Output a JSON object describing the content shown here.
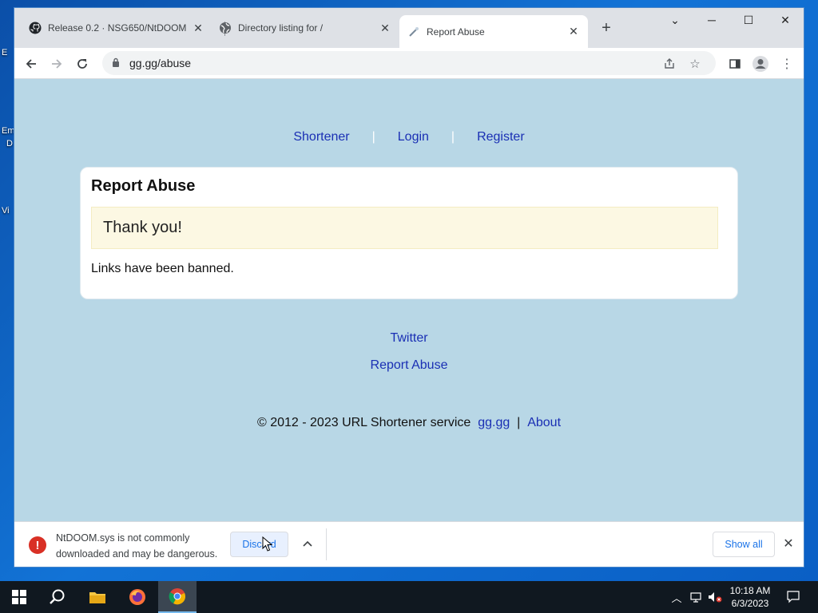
{
  "desktop": {
    "icons": [
      "E",
      "Em",
      "D",
      "Vi"
    ]
  },
  "browser": {
    "tabs": [
      {
        "title": "Release 0.2 · NSG650/NtDOOM",
        "icon": "github-icon"
      },
      {
        "title": "Directory listing for /",
        "icon": "globe-icon"
      },
      {
        "title": "Report Abuse",
        "icon": "link-icon",
        "active": true
      }
    ],
    "url": "gg.gg/abuse"
  },
  "page": {
    "nav": {
      "shortener": "Shortener",
      "sep1": "|",
      "login": "Login",
      "sep2": "|",
      "register": "Register"
    },
    "card": {
      "title": "Report Abuse",
      "alert": "Thank you!",
      "message": "Links have been banned."
    },
    "footer": {
      "twitter": "Twitter",
      "report": "Report Abuse",
      "copyright": "© 2012 - 2023 URL Shortener service",
      "site": "gg.gg",
      "divider": "|",
      "about": "About"
    }
  },
  "download": {
    "line1": "NtDOOM.sys is not commonly",
    "line2": "downloaded and may be dangerous.",
    "discard": "Discard",
    "show_all": "Show all"
  },
  "taskbar": {
    "time": "10:18 AM",
    "date": "6/3/2023"
  }
}
